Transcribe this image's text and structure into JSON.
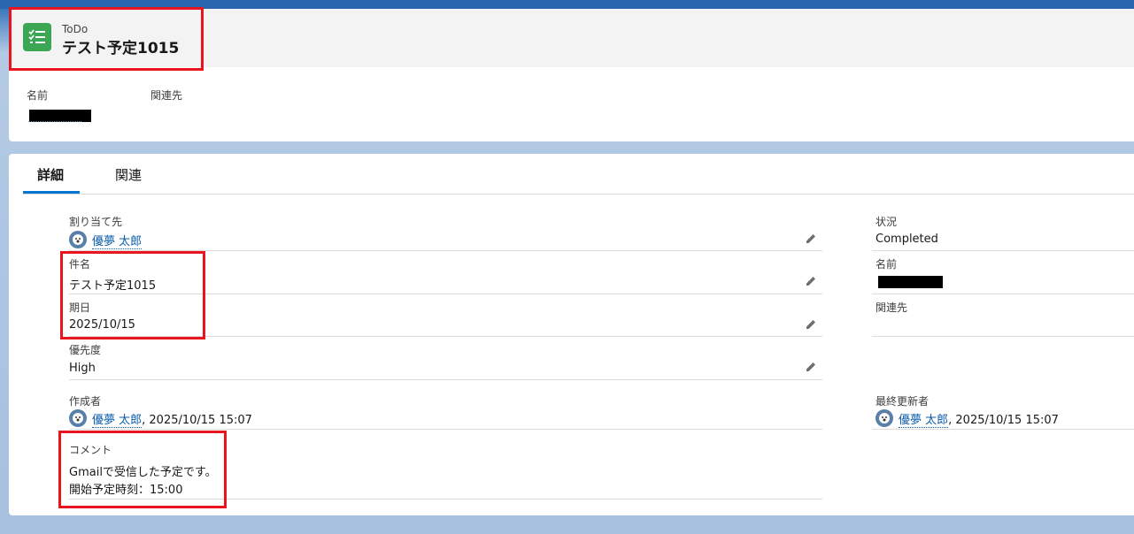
{
  "header": {
    "object_label": "ToDo",
    "title": "テスト予定1015",
    "fields": [
      {
        "label": "名前"
      },
      {
        "label": "関連先"
      }
    ]
  },
  "tabs": [
    {
      "label": "詳細",
      "active": true
    },
    {
      "label": "関連",
      "active": false
    }
  ],
  "details": {
    "assignee": {
      "label": "割り当て先",
      "value": "優夢 太郎"
    },
    "subject": {
      "label": "件名",
      "value": "テスト予定1015"
    },
    "due_date": {
      "label": "期日",
      "value": "2025/10/15"
    },
    "priority": {
      "label": "優先度",
      "value": "High"
    },
    "created_by": {
      "label": "作成者",
      "user": "優夢 太郎",
      "datetime": ", 2025/10/15 15:07"
    },
    "comment": {
      "label": "コメント",
      "line1": "Gmailで受信した予定です。",
      "line2": "開始予定時刻：15:00"
    },
    "status": {
      "label": "状況",
      "value": "Completed"
    },
    "name": {
      "label": "名前"
    },
    "related_to": {
      "label": "関連先"
    },
    "last_modified_by": {
      "label": "最終更新者",
      "user": "優夢 太郎",
      "datetime": ", 2025/10/15 15:07"
    }
  },
  "icons": [
    "todo-list-icon",
    "pencil-icon",
    "user-avatar-icon"
  ],
  "colors": {
    "accent": "#0176d3",
    "link": "#0b5cab",
    "object_icon": "#3ba755",
    "highlight": "#e8151f"
  }
}
